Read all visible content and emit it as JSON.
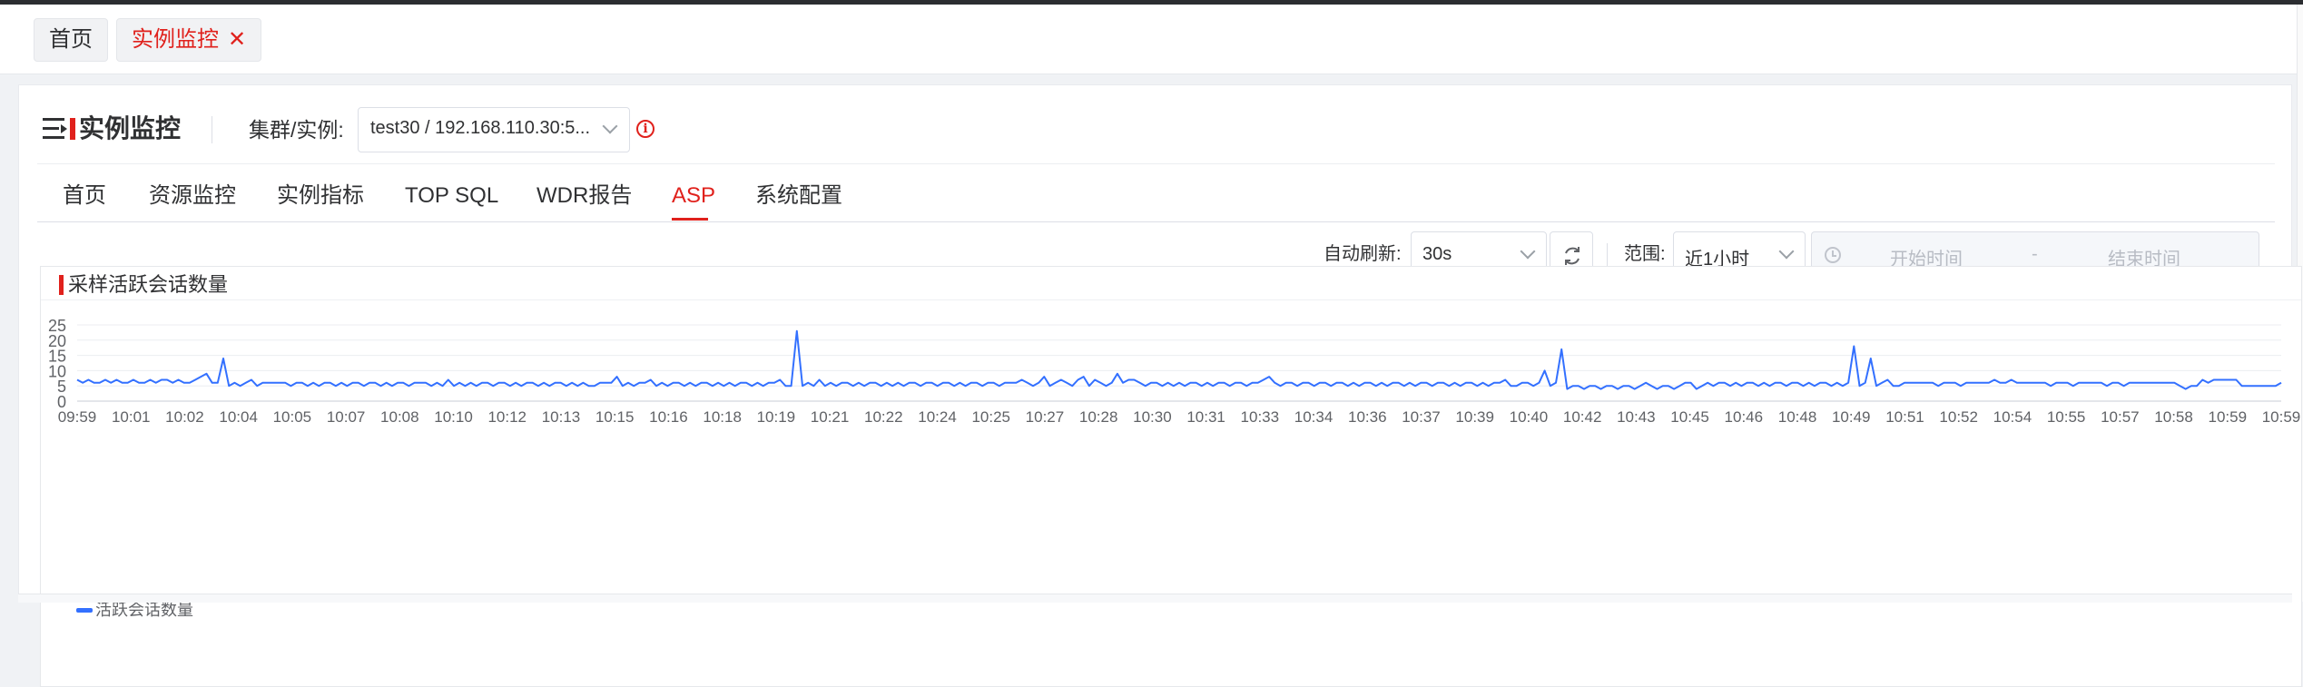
{
  "page_tabs": [
    {
      "label": "首页"
    },
    {
      "label": "实例监控",
      "close": "✕"
    }
  ],
  "header": {
    "title": "实例监控",
    "cluster_label": "集群/实例:",
    "cluster_value": "test30 / 192.168.110.30:5..."
  },
  "nav": {
    "items": [
      "首页",
      "资源监控",
      "实例指标",
      "TOP SQL",
      "WDR报告",
      "ASP",
      "系统配置"
    ],
    "active": "ASP"
  },
  "toolbar": {
    "auto_refresh_label": "自动刷新:",
    "auto_refresh_value": "30s",
    "range_label": "范围:",
    "range_value": "近1小时",
    "start_placeholder": "开始时间",
    "range_separator": "-",
    "end_placeholder": "结束时间"
  },
  "colors": {
    "accent": "#e0211c",
    "series": "#3370ff"
  },
  "card": {
    "title": "采样活跃会话数量"
  },
  "chart_data": {
    "type": "line",
    "ylim": [
      0,
      25
    ],
    "y_ticks": [
      0,
      5,
      10,
      15,
      20,
      25
    ],
    "x_tick_labels": [
      "09:59",
      "10:01",
      "10:02",
      "10:04",
      "10:05",
      "10:07",
      "10:08",
      "10:10",
      "10:12",
      "10:13",
      "10:15",
      "10:16",
      "10:18",
      "10:19",
      "10:21",
      "10:22",
      "10:24",
      "10:25",
      "10:27",
      "10:28",
      "10:30",
      "10:31",
      "10:33",
      "10:34",
      "10:36",
      "10:37",
      "10:39",
      "10:40",
      "10:42",
      "10:43",
      "10:45",
      "10:46",
      "10:48",
      "10:49",
      "10:51",
      "10:52",
      "10:54",
      "10:55",
      "10:57",
      "10:58",
      "10:59",
      "10:59"
    ],
    "grid": true,
    "legend_position": "bottom-left",
    "series": [
      {
        "name": "活跃会话数量",
        "values": [
          7,
          6,
          7,
          6,
          6,
          7,
          6,
          7,
          6,
          6,
          7,
          6,
          6,
          7,
          6,
          7,
          7,
          6,
          7,
          6,
          6,
          7,
          8,
          9,
          6,
          6,
          14,
          5,
          6,
          5,
          6,
          7,
          5,
          6,
          6,
          6,
          6,
          6,
          5,
          6,
          6,
          5,
          6,
          5,
          6,
          6,
          5,
          6,
          5,
          6,
          6,
          5,
          6,
          6,
          5,
          6,
          5,
          6,
          6,
          5,
          6,
          6,
          6,
          5,
          6,
          5,
          7,
          5,
          6,
          5,
          6,
          5,
          6,
          6,
          5,
          6,
          6,
          5,
          6,
          5,
          6,
          6,
          5,
          6,
          5,
          6,
          6,
          5,
          6,
          5,
          6,
          5,
          5,
          6,
          6,
          6,
          8,
          5,
          6,
          5,
          6,
          6,
          7,
          5,
          6,
          5,
          6,
          6,
          5,
          6,
          5,
          6,
          6,
          5,
          6,
          5,
          6,
          5,
          6,
          6,
          5,
          6,
          5,
          6,
          6,
          7,
          5,
          5,
          23,
          5,
          6,
          5,
          7,
          5,
          6,
          5,
          6,
          6,
          5,
          6,
          5,
          6,
          6,
          5,
          6,
          5,
          6,
          5,
          6,
          6,
          5,
          6,
          6,
          5,
          6,
          6,
          5,
          6,
          5,
          6,
          6,
          5,
          6,
          6,
          5,
          6,
          6,
          6,
          7,
          6,
          5,
          6,
          8,
          5,
          6,
          7,
          6,
          5,
          7,
          8,
          5,
          7,
          6,
          5,
          6,
          9,
          6,
          7,
          7,
          6,
          5,
          6,
          6,
          5,
          6,
          5,
          6,
          5,
          6,
          6,
          5,
          6,
          5,
          6,
          6,
          5,
          6,
          6,
          5,
          6,
          6,
          7,
          8,
          6,
          5,
          6,
          6,
          5,
          6,
          6,
          5,
          6,
          6,
          5,
          6,
          6,
          5,
          6,
          5,
          6,
          6,
          5,
          6,
          5,
          6,
          6,
          5,
          6,
          5,
          6,
          6,
          5,
          6,
          6,
          5,
          6,
          5,
          6,
          6,
          5,
          6,
          5,
          6,
          6,
          7,
          5,
          5,
          6,
          6,
          5,
          6,
          10,
          5,
          6,
          17,
          4,
          5,
          5,
          4,
          5,
          5,
          4,
          5,
          5,
          4,
          5,
          5,
          4,
          5,
          6,
          5,
          4,
          5,
          5,
          4,
          5,
          6,
          6,
          4,
          5,
          6,
          5,
          6,
          6,
          5,
          6,
          5,
          6,
          6,
          5,
          6,
          5,
          6,
          6,
          5,
          6,
          6,
          5,
          6,
          5,
          6,
          6,
          5,
          6,
          5,
          6,
          18,
          5,
          6,
          14,
          5,
          6,
          7,
          5,
          5,
          6,
          6,
          6,
          6,
          6,
          6,
          5,
          6,
          6,
          6,
          5,
          6,
          6,
          6,
          6,
          6,
          7,
          6,
          6,
          7,
          6,
          6,
          6,
          6,
          6,
          6,
          5,
          6,
          6,
          6,
          5,
          6,
          6,
          6,
          6,
          6,
          5,
          6,
          6,
          5,
          6,
          6,
          6,
          6,
          6,
          6,
          6,
          6,
          6,
          5,
          4,
          5,
          5,
          7,
          6,
          7,
          7,
          7,
          7,
          7,
          5,
          5,
          5,
          5,
          5,
          5,
          5,
          6
        ]
      }
    ]
  }
}
